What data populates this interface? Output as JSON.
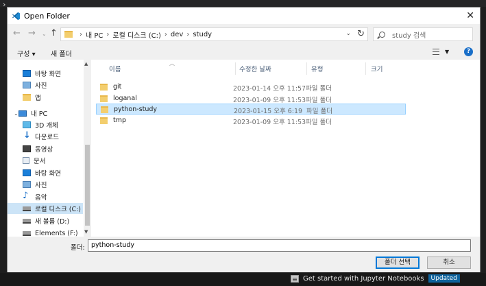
{
  "window": {
    "title": "Open Folder"
  },
  "address": {
    "crumbs": [
      "내 PC",
      "로컬 디스크 (C:)",
      "dev",
      "study"
    ]
  },
  "search": {
    "placeholder": "study 검색"
  },
  "toolbar": {
    "organize": "구성 ▾",
    "new_folder": "새 폴더",
    "help": "?"
  },
  "sidebar": {
    "items": [
      {
        "label": "바탕 화면",
        "icon": "desktop-icon"
      },
      {
        "label": "사진",
        "icon": "pictures-icon"
      },
      {
        "label": "앱",
        "icon": "folder-icon"
      },
      {
        "label": "내 PC",
        "icon": "this-pc-icon"
      },
      {
        "label": "3D 개체",
        "icon": "3d-objects-icon"
      },
      {
        "label": "다운로드",
        "icon": "downloads-icon"
      },
      {
        "label": "동영상",
        "icon": "videos-icon"
      },
      {
        "label": "문서",
        "icon": "documents-icon"
      },
      {
        "label": "바탕 화면",
        "icon": "desktop-icon"
      },
      {
        "label": "사진",
        "icon": "pictures-icon"
      },
      {
        "label": "음악",
        "icon": "music-icon"
      },
      {
        "label": "로컬 디스크 (C:)",
        "icon": "drive-icon"
      },
      {
        "label": "새 볼륨 (D:)",
        "icon": "drive-icon"
      },
      {
        "label": "Elements (F:)",
        "icon": "drive-icon"
      }
    ]
  },
  "columns": {
    "name": "이름",
    "date": "수정한 날짜",
    "type": "유형",
    "size": "크기"
  },
  "files": [
    {
      "name": "git",
      "date": "2023-01-14 오후 11:57",
      "type": "파일 폴더"
    },
    {
      "name": "loganal",
      "date": "2023-01-09 오후 11:53",
      "type": "파일 폴더"
    },
    {
      "name": "python-study",
      "date": "2023-01-15 오후 6:19",
      "type": "파일 폴더"
    },
    {
      "name": "tmp",
      "date": "2023-01-09 오후 11:53",
      "type": "파일 폴더"
    }
  ],
  "footer": {
    "folder_label": "폴더:",
    "folder_value": "python-study",
    "select_button": "폴더 선택",
    "cancel_button": "취소"
  },
  "background": {
    "notification": "Get started with Jupyter Notebooks",
    "badge": "Updated"
  },
  "colors": {
    "accent": "#0078d7",
    "selection": "#cce8ff"
  }
}
